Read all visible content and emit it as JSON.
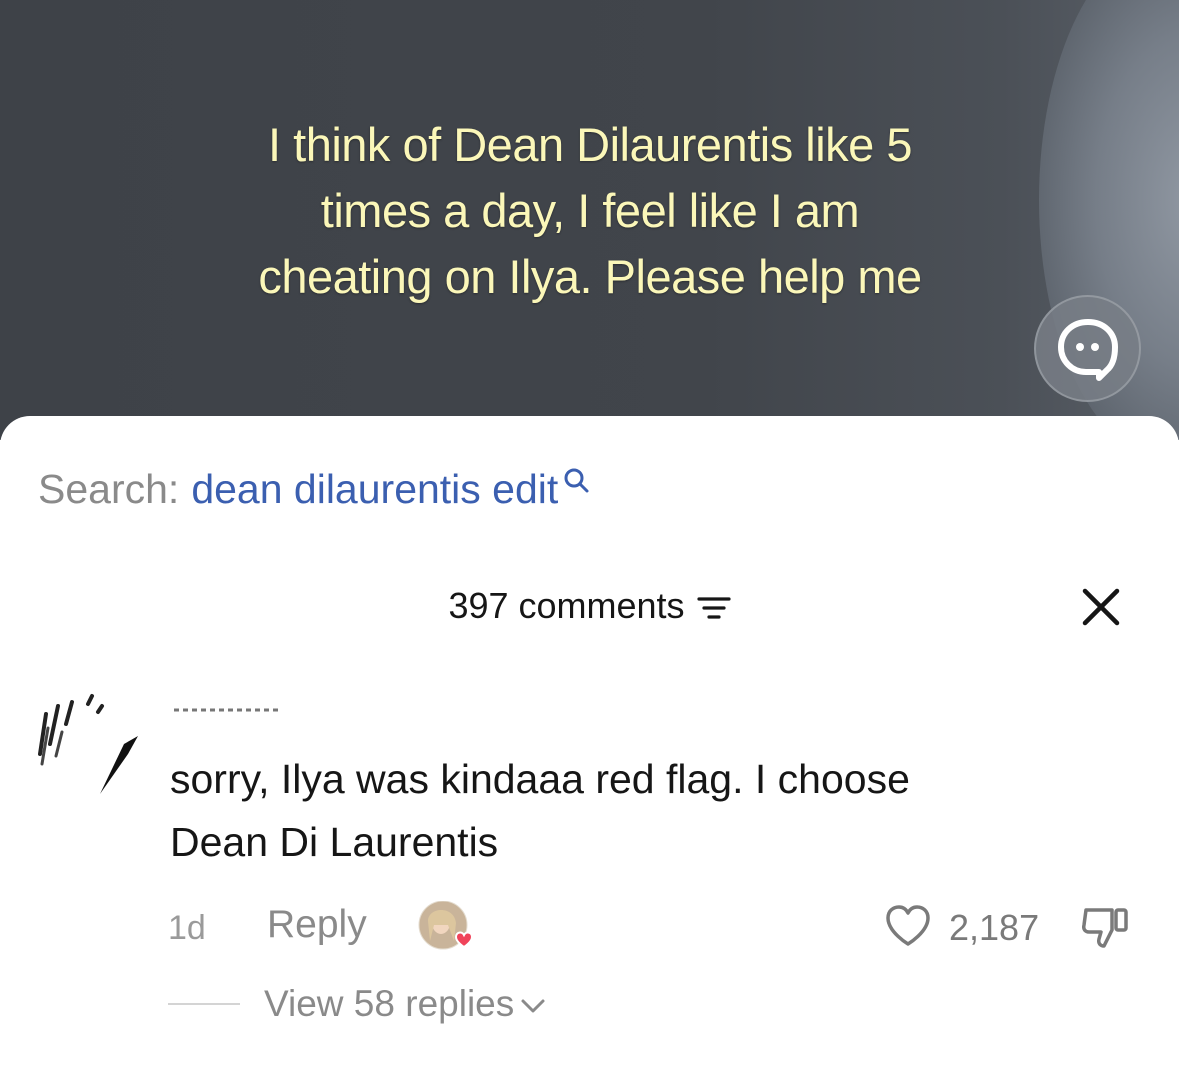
{
  "video": {
    "caption_lines": [
      "I think of Dean Dilaurentis like 5",
      "times a day, I feel like I am",
      "cheating on Ilya. Please help me"
    ],
    "chat_icon": "chat-bubble-icon"
  },
  "search": {
    "prefix": "Search:",
    "query": "dean dilaurentis edit",
    "icon": "search-icon"
  },
  "comments": {
    "count_label": "397 comments",
    "sort_icon": "sort-icon",
    "close_icon": "close-icon"
  },
  "comment": {
    "text_lines": [
      "sorry, Ilya was kindaaa red flag. I choose",
      "Dean Di Laurentis"
    ],
    "time": "1d",
    "reply_label": "Reply",
    "like_count": "2,187",
    "view_replies_label": "View 58 replies"
  },
  "colors": {
    "caption": "#fbf7b9",
    "search_query": "#3b5fb0",
    "muted": "#8a8a8a",
    "heart": "#f0435a"
  }
}
